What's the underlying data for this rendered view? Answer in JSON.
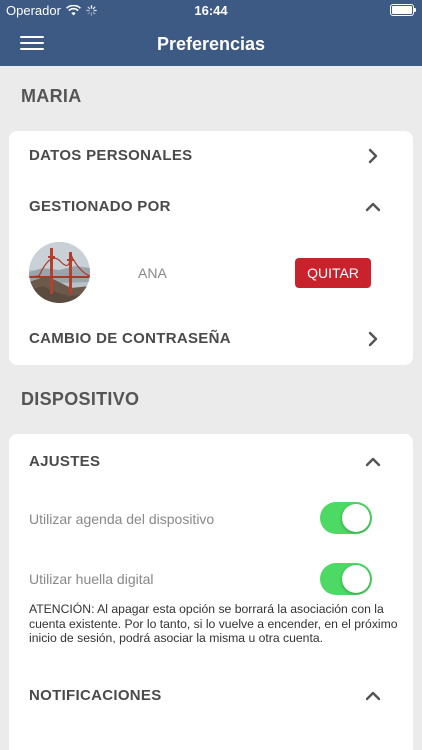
{
  "status_bar": {
    "carrier": "Operador",
    "time": "16:44"
  },
  "nav": {
    "title": "Preferencias"
  },
  "user_section": {
    "title": "MARIA"
  },
  "account_card": {
    "personal_data_label": "DATOS PERSONALES",
    "managed_by_label": "GESTIONADO POR",
    "manager_name": "ANA",
    "remove_button_label": "QUITAR",
    "password_change_label": "CAMBIO DE CONTRASEÑA"
  },
  "device_section": {
    "title": "DISPOSITIVO"
  },
  "device_card": {
    "settings_label": "AJUSTES",
    "use_agenda_label": "Utilizar agenda del dispositivo",
    "use_agenda_on": true,
    "use_fingerprint_label": "Utilizar huella digital",
    "use_fingerprint_on": true,
    "warning_text": "ATENCIÓN: Al apagar esta opción se borrará la asociación con la cuenta existente. Por lo tanto, si lo vuelve a encender, en el próximo inicio de sesión, podrá asociar la misma u otra cuenta.",
    "notifications_label": "NOTIFICACIONES"
  },
  "colors": {
    "nav_background": "#3d5a85",
    "toggle_on": "#4cd964",
    "remove_button": "#c8232c"
  }
}
